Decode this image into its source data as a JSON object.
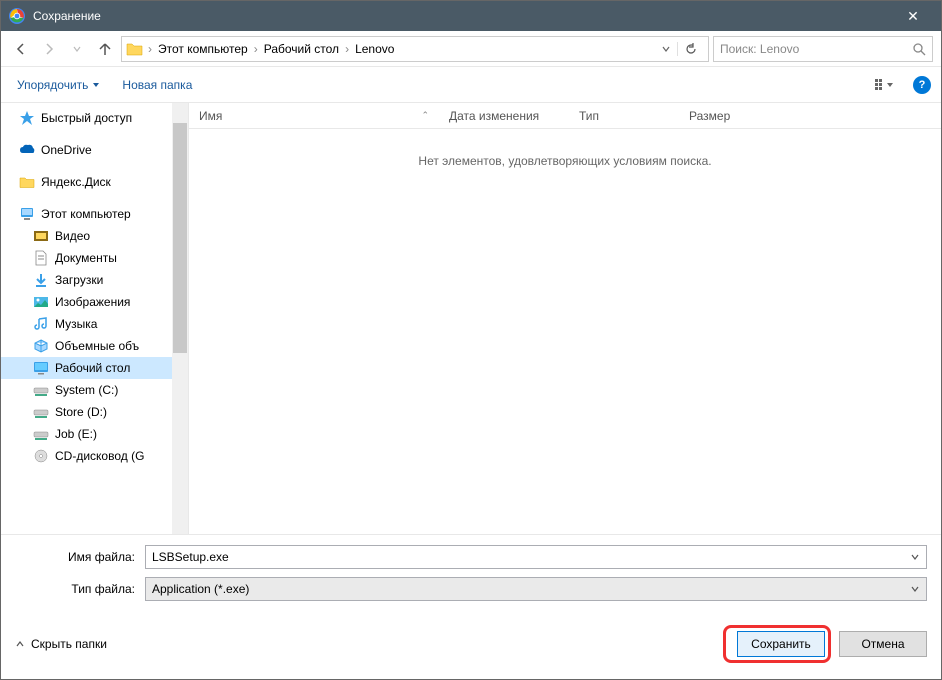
{
  "titlebar": {
    "title": "Сохранение"
  },
  "nav": {
    "crumbs": [
      "Этот компьютер",
      "Рабочий стол",
      "Lenovo"
    ],
    "search_placeholder": "Поиск: Lenovo"
  },
  "toolbar": {
    "organize": "Упорядочить",
    "newfolder": "Новая папка"
  },
  "columns": {
    "name": "Имя",
    "date": "Дата изменения",
    "type": "Тип",
    "size": "Размер"
  },
  "empty": "Нет элементов, удовлетворяющих условиям поиска.",
  "sidebar": {
    "quickaccess": "Быстрый доступ",
    "onedrive": "OneDrive",
    "yandex": "Яндекс.Диск",
    "thispc": "Этот компьютер",
    "video": "Видео",
    "documents": "Документы",
    "downloads": "Загрузки",
    "pictures": "Изображения",
    "music": "Музыка",
    "volumes3d": "Объемные объ",
    "desktop": "Рабочий стол",
    "systemc": "System (C:)",
    "stored": "Store (D:)",
    "jobe": "Job (E:)",
    "cddrive": "CD-дисковод (G"
  },
  "bottom": {
    "fname_label": "Имя файла:",
    "fname_value": "LSBSetup.exe",
    "ftype_label": "Тип файла:",
    "ftype_value": "Application (*.exe)"
  },
  "actions": {
    "hide": "Скрыть папки",
    "save": "Сохранить",
    "cancel": "Отмена"
  }
}
